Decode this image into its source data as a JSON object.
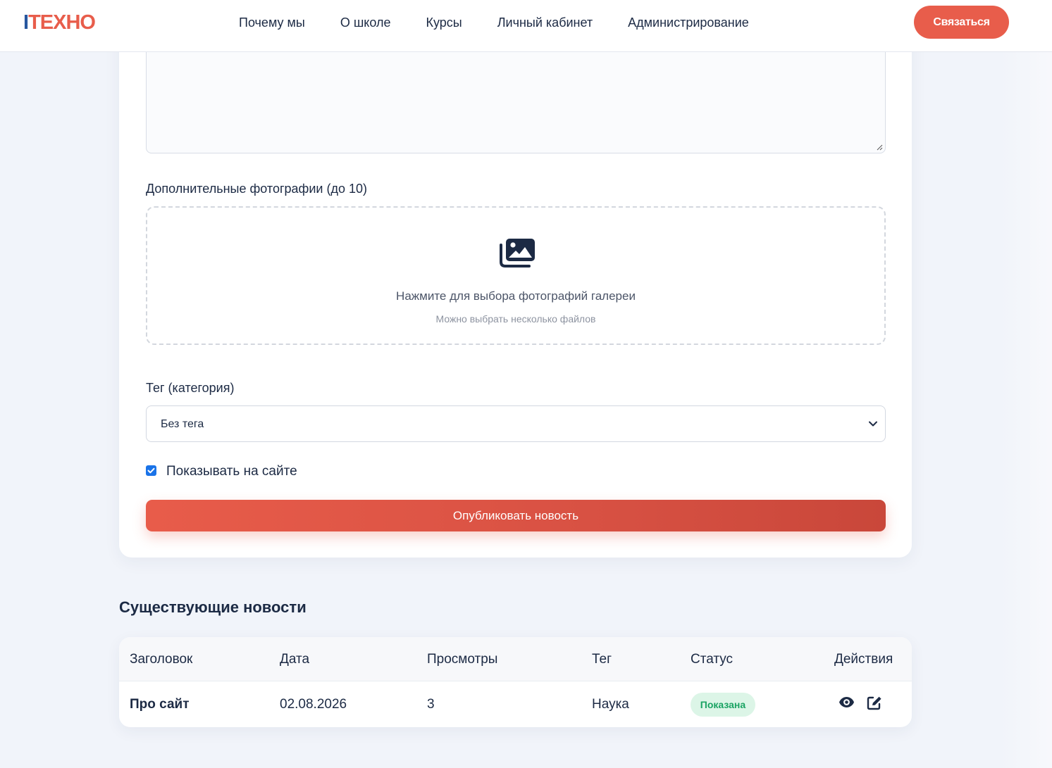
{
  "header": {
    "logo_part1": "I",
    "logo_part2": "TEXHO",
    "nav": [
      "Почему мы",
      "О школе",
      "Курсы",
      "Личный кабинет",
      "Администрирование"
    ],
    "contact_label": "Связаться"
  },
  "form": {
    "photos_label": "Дополнительные фотографии (до 10)",
    "dropzone_main": "Нажмите для выбора фотографий галереи",
    "dropzone_sub": "Можно выбрать несколько файлов",
    "tag_label": "Тег (категория)",
    "tag_selected": "Без тега",
    "show_on_site_label": "Показывать на сайте",
    "show_on_site_checked": true,
    "publish_label": "Опубликовать новость"
  },
  "news": {
    "title": "Существующие новости",
    "columns": [
      "Заголовок",
      "Дата",
      "Просмотры",
      "Тег",
      "Статус",
      "Действия"
    ],
    "rows": [
      {
        "title": "Про сайт",
        "date": "02.08.2026",
        "views": "3",
        "tag": "Наука",
        "status": "Показана"
      }
    ]
  },
  "colors": {
    "accent": "#e85d4b",
    "logo_blue": "#27579e",
    "status_green": "#1aa363",
    "text_dark": "#1c2a44"
  },
  "icons": {
    "dropzone": "images-icon",
    "select": "chevron-down-icon",
    "view": "eye-icon",
    "edit": "edit-icon"
  }
}
